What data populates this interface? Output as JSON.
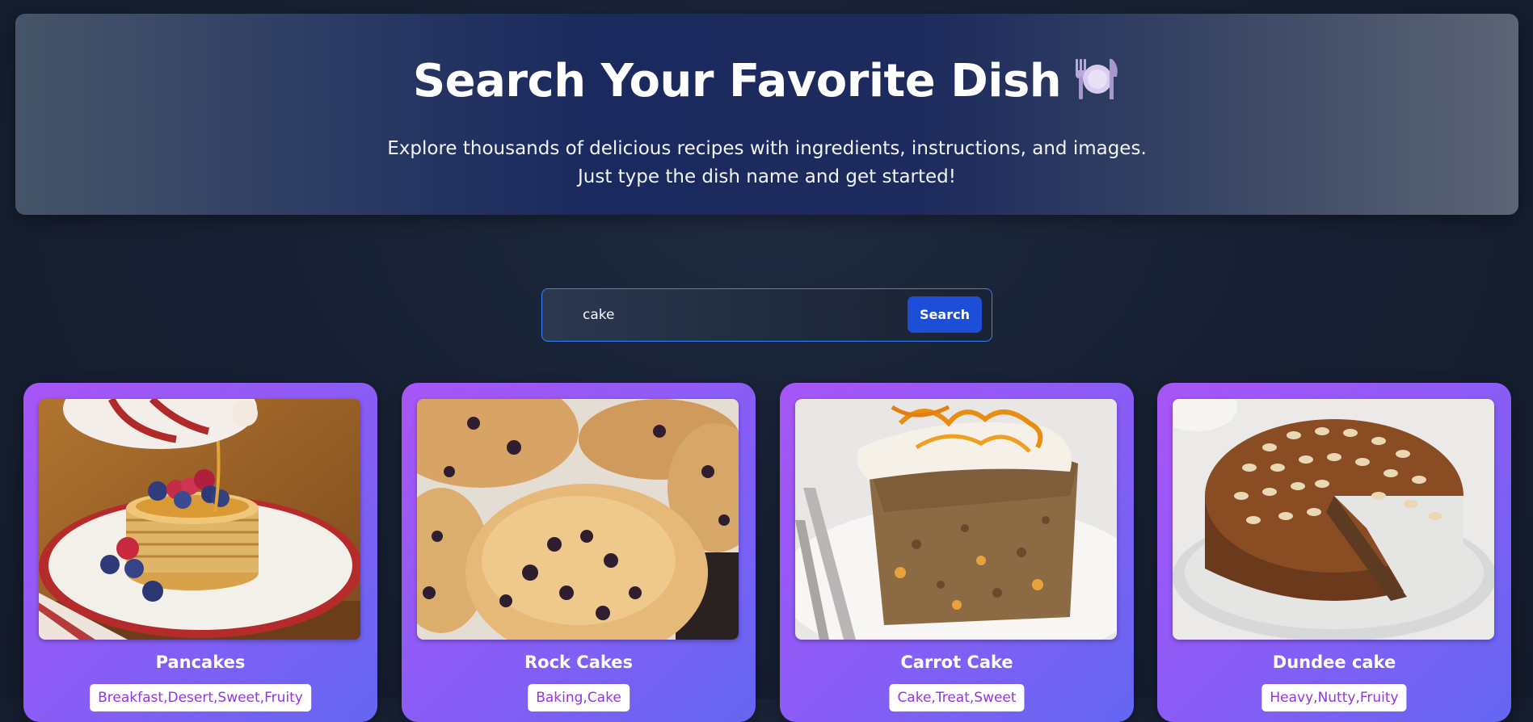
{
  "hero": {
    "title": "Search Your Favorite Dish",
    "icon": "plate-cutlery-icon",
    "subtitle_line1": "Explore thousands of delicious recipes with ingredients, instructions, and images.",
    "subtitle_line2": "Just type the dish name and get started!"
  },
  "search": {
    "value": "cake",
    "button_label": "Search"
  },
  "results": [
    {
      "title": "Pancakes",
      "tags": "Breakfast,Desert,Sweet,Fruity",
      "image": "pancakes-image"
    },
    {
      "title": "Rock Cakes",
      "tags": "Baking,Cake",
      "image": "rock-cakes-image"
    },
    {
      "title": "Carrot Cake",
      "tags": "Cake,Treat,Sweet",
      "image": "carrot-cake-image"
    },
    {
      "title": "Dundee cake",
      "tags": "Heavy,Nutty,Fruity",
      "image": "dundee-cake-image"
    }
  ],
  "colors": {
    "page_background": "#172033",
    "card_gradient_start": "#a855f7",
    "card_gradient_end": "#6366f1",
    "search_button": "#1d4ed8",
    "search_border": "#3b82f6",
    "tag_text": "#9333ea"
  }
}
